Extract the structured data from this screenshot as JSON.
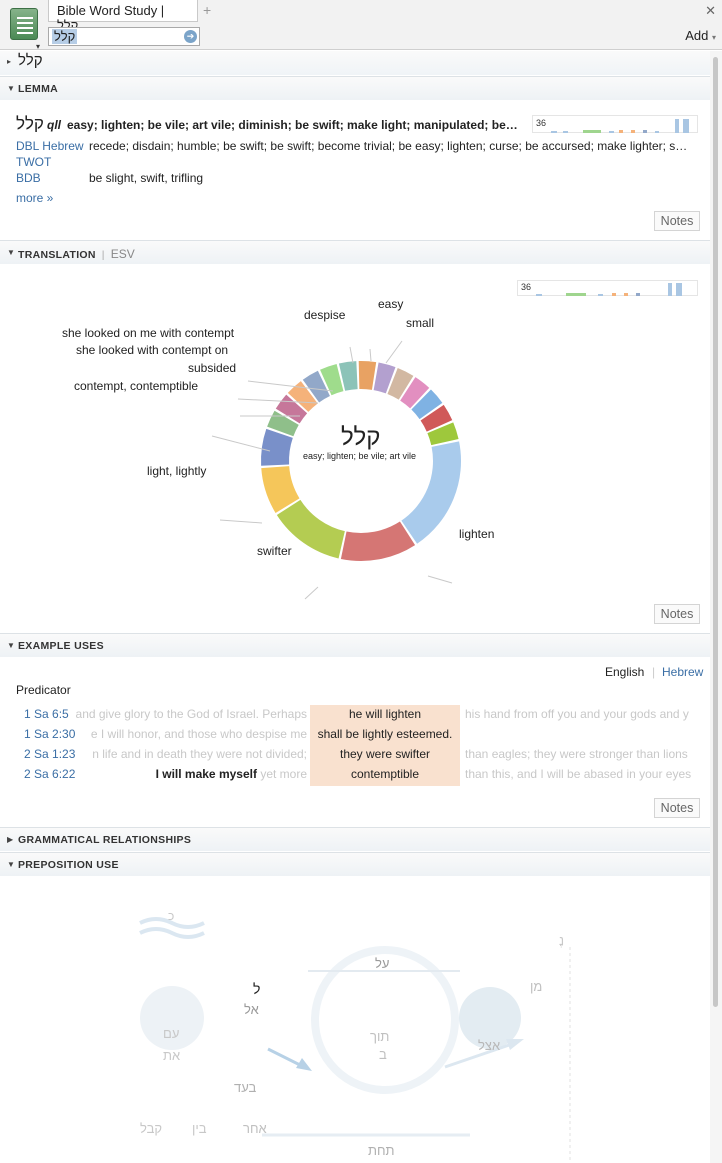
{
  "app": {
    "tab_title": "Bible Word Study | קלל",
    "search_value": "קלל",
    "add_label": "Add"
  },
  "breadcrumb": "קלל",
  "lemma": {
    "heading": "LEMMA",
    "word": "קלל",
    "translit": "qll",
    "gloss": "easy; lighten; be vile; art vile; diminish; be swift; make light; manipulated; be…",
    "hist_count": "36",
    "rows": [
      {
        "source": "DBL Hebrew",
        "def": "recede; disdain; humble; be swift; be swift; become trivial; be easy; lighten; curse; be accursed; make lighter; s…"
      },
      {
        "source": "TWOT",
        "def": ""
      },
      {
        "source": "BDB",
        "def": "be slight, swift, trifling"
      }
    ],
    "more": "more »",
    "notes": "Notes"
  },
  "translation": {
    "heading": "TRANSLATION",
    "version": "ESV",
    "hist_count": "36",
    "center_word": "קלל",
    "center_gloss": "easy; lighten; be vile; art vile",
    "notes": "Notes",
    "labels": {
      "easy": "easy",
      "small": "small",
      "despise": "despise",
      "looked_contempt": "she looked on me with contempt",
      "looked_on": "she looked with contempt on",
      "subsided": "subsided",
      "contempt": "contempt, contemptible",
      "light": "light, lightly",
      "swifter": "swifter",
      "lighten": "lighten"
    }
  },
  "chart_data": {
    "type": "pie",
    "title": "קלל",
    "subtitle": "easy; lighten; be vile; art vile",
    "slices": [
      {
        "label": "lighten",
        "value": 12,
        "color": "#a9cbec"
      },
      {
        "label": "swifter",
        "value": 8,
        "color": "#d57674"
      },
      {
        "label": "light, lightly",
        "value": 8,
        "color": "#b4cc52"
      },
      {
        "label": "contempt, contemptible",
        "value": 5,
        "color": "#f5c65a"
      },
      {
        "label": "",
        "value": 4,
        "color": "#7990c9"
      },
      {
        "label": "subsided",
        "value": 2,
        "color": "#8fbf8a"
      },
      {
        "label": "she looked with contempt on",
        "value": 2,
        "color": "#c6779a"
      },
      {
        "label": "she looked on me with contempt",
        "value": 2,
        "color": "#f5b27a"
      },
      {
        "label": "despise",
        "value": 2,
        "color": "#92a8c9"
      },
      {
        "label": "easy",
        "value": 2,
        "color": "#9fdc8c"
      },
      {
        "label": "small",
        "value": 2,
        "color": "#8cc3b8"
      },
      {
        "label": "",
        "value": 2,
        "color": "#e8a263"
      },
      {
        "label": "",
        "value": 2,
        "color": "#b3a0cf"
      },
      {
        "label": "",
        "value": 2,
        "color": "#d2b8a2"
      },
      {
        "label": "",
        "value": 2,
        "color": "#e28fc0"
      },
      {
        "label": "",
        "value": 2,
        "color": "#7fb2e3"
      },
      {
        "label": "",
        "value": 2,
        "color": "#d05959"
      },
      {
        "label": "",
        "value": 2,
        "color": "#9ec83c"
      }
    ]
  },
  "examples": {
    "heading": "EXAMPLE USES",
    "lang_english": "English",
    "lang_hebrew": "Hebrew",
    "role": "Predicator",
    "notes": "Notes",
    "rows": [
      {
        "ref": "1 Sa 6:5",
        "left": "and give glory to the God of Israel. Perhaps",
        "mid": "he will lighten",
        "right": "his hand from off you and your gods and y"
      },
      {
        "ref": "1 Sa 2:30",
        "left": "e I will honor, and those who despise me",
        "mid": "shall be lightly esteemed.",
        "right": ""
      },
      {
        "ref": "2 Sa 1:23",
        "left": "n life and in death they were not divided;",
        "mid": "they were swifter",
        "right": "than eagles; they were stronger than lions"
      },
      {
        "ref": "2 Sa 6:22",
        "left_bold": "I will make myself",
        "left": "yet more",
        "mid": "contemptible",
        "right": "than this, and I will be abased in your eyes"
      }
    ]
  },
  "grammar": {
    "heading": "GRAMMATICAL RELATIONSHIPS"
  },
  "preposition": {
    "heading": "PREPOSITION USE",
    "labels": {
      "al": "על",
      "l": "ל",
      "el": "אל",
      "min": "מן",
      "tokh": "תוך",
      "b": "ב",
      "etsel": "אצל",
      "im": "עם",
      "et": "את",
      "bead": "בעד",
      "ahar": "אחר",
      "bein": "בין",
      "kabel": "קבל",
      "tahat": "תחת",
      "k": "כ",
      "top_right": "נֶ"
    }
  }
}
